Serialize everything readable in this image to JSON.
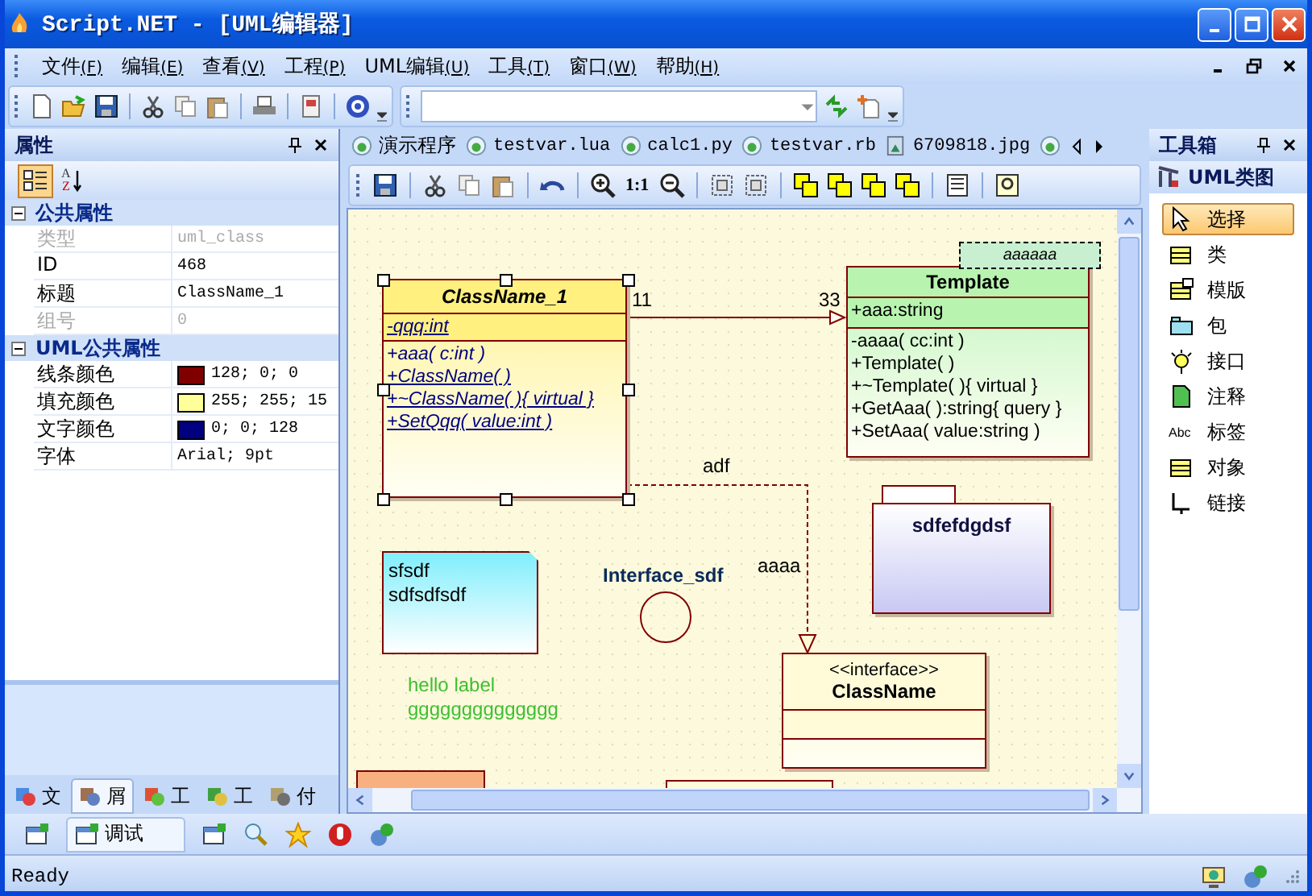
{
  "window": {
    "title": "Script.NET - [UML编辑器]"
  },
  "menu": [
    {
      "label": "文件",
      "accel": "(F)"
    },
    {
      "label": "编辑",
      "accel": "(E)"
    },
    {
      "label": "查看",
      "accel": "(V)"
    },
    {
      "label": "工程",
      "accel": "(P)"
    },
    {
      "label": "UML编辑",
      "accel": "(U)"
    },
    {
      "label": "工具",
      "accel": "(T)"
    },
    {
      "label": "窗口",
      "accel": "(W)"
    },
    {
      "label": "帮助",
      "accel": "(H)"
    }
  ],
  "properties": {
    "title": "属性",
    "toolbar": [
      {
        "kind": "categorized",
        "selected": true
      },
      {
        "kind": "alphabetical",
        "letters": [
          "A",
          "Z"
        ],
        "selected": false
      }
    ],
    "groups": [
      {
        "title": "公共属性",
        "expanded": true,
        "rows": [
          {
            "name": "类型",
            "value": "uml_class",
            "disabled": true
          },
          {
            "name": "ID",
            "value": "468",
            "disabled": false
          },
          {
            "name": "标题",
            "value": "ClassName_1",
            "disabled": false
          },
          {
            "name": "组号",
            "value": "0",
            "disabled": true
          }
        ]
      },
      {
        "title": "UML公共属性",
        "expanded": true,
        "rows": [
          {
            "name": "线条颜色",
            "value": "128; 0; 0",
            "disabled": false,
            "color": "#800000"
          },
          {
            "name": "填充颜色",
            "value": "255; 255; 15",
            "disabled": false,
            "color": "#ffff99"
          },
          {
            "name": "文字颜色",
            "value": "0; 0; 128",
            "disabled": false,
            "color": "#000080"
          },
          {
            "name": "字体",
            "value": "Arial; 9pt",
            "disabled": false
          }
        ]
      }
    ]
  },
  "side_tabs": [
    {
      "label": "文",
      "selected": false
    },
    {
      "label": "屑",
      "selected": true
    },
    {
      "label": "工",
      "selected": false
    },
    {
      "label": "工",
      "selected": false
    },
    {
      "label": "付",
      "selected": false
    }
  ],
  "doc_tabs": [
    {
      "label": "演示程序"
    },
    {
      "label": "testvar.lua"
    },
    {
      "label": "calc1.py"
    },
    {
      "label": "testvar.rb"
    },
    {
      "label": "6709818.jpg",
      "kind": "image"
    }
  ],
  "canvas_toolbar": {
    "zoom_reset": "1:1"
  },
  "diagram": {
    "nodes": [
      {
        "kind": "class",
        "name": "ClassName_1",
        "abstract": true,
        "selected": true,
        "color": "#fff080",
        "attributes": [
          {
            "text": "-qqq:int",
            "static": true
          }
        ],
        "methods": [
          {
            "text": "+aaa( c:int )",
            "static": false
          },
          {
            "text": "+ClassName( )",
            "static": true
          },
          {
            "text": "+~ClassName( ){ virtual }",
            "static": true
          },
          {
            "text": "+SetQqq( value:int )",
            "static": true
          }
        ]
      },
      {
        "kind": "tag",
        "text": "aaaaaa"
      },
      {
        "kind": "class",
        "name": "Template",
        "abstract": false,
        "selected": false,
        "color": "#b8f4b0",
        "attributes": [
          {
            "text": "+aaa:string",
            "static": false
          }
        ],
        "methods": [
          {
            "text": "-aaaa( cc:int )",
            "static": false
          },
          {
            "text": "+Template( )",
            "static": false
          },
          {
            "text": "+~Template( ){ virtual }",
            "static": false
          },
          {
            "text": "+GetAaa( ):string{ query }",
            "static": false
          },
          {
            "text": "+SetAaa( value:string )",
            "static": false
          }
        ]
      },
      {
        "kind": "package",
        "name": "sdfefdgdsf"
      },
      {
        "kind": "note",
        "lines": [
          "sfsdf",
          "sdfsdfsdf"
        ]
      },
      {
        "kind": "lollipop",
        "name": "Interface_sdf"
      },
      {
        "kind": "class",
        "stereotype": "<<interface>>",
        "name": "ClassName",
        "abstract": false,
        "selected": false,
        "color": "#fffbd8"
      },
      {
        "kind": "label",
        "lines": [
          "hello label",
          "gggggggggggggg"
        ]
      },
      {
        "kind": "clipped",
        "color": "#f8b080"
      },
      {
        "kind": "clipped",
        "color": "#fffbd8"
      }
    ],
    "connectors": [
      {
        "kind": "association",
        "source_label": "11",
        "target_label": "33"
      },
      {
        "kind": "dependency",
        "label": "adf",
        "target_label": "aaaa"
      }
    ]
  },
  "toolbox": {
    "title": "工具箱",
    "section": "UML类图",
    "items": [
      {
        "kind": "select",
        "label": "选择",
        "selected": true
      },
      {
        "kind": "class",
        "label": "类",
        "selected": false
      },
      {
        "kind": "template",
        "label": "模版",
        "selected": false
      },
      {
        "kind": "package",
        "label": "包",
        "selected": false
      },
      {
        "kind": "interface",
        "label": "接口",
        "selected": false
      },
      {
        "kind": "note",
        "label": "注释",
        "selected": false
      },
      {
        "kind": "label",
        "label": "标签",
        "icon_text": "Abc",
        "selected": false
      },
      {
        "kind": "object",
        "label": "对象",
        "selected": false
      },
      {
        "kind": "link",
        "label": "链接",
        "selected": false
      }
    ]
  },
  "output_tabs": [
    {
      "label": "调试",
      "selected": true
    }
  ],
  "status_bar": {
    "text": "Ready"
  }
}
